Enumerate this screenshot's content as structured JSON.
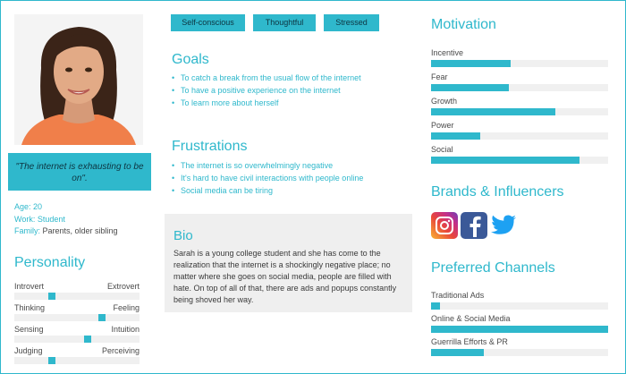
{
  "quote": "\"The internet is exhausting to be on\".",
  "details": {
    "age_label": "Age:",
    "age_value": "20",
    "work_label": "Work:",
    "work_value": "Student",
    "family_label": "Family:",
    "family_value": "Parents, older sibling"
  },
  "personality": {
    "title": "Personality",
    "rows": [
      {
        "left": "Introvert",
        "right": "Extrovert",
        "value": 0.29
      },
      {
        "left": "Thinking",
        "right": "Feeling",
        "value": 0.71
      },
      {
        "left": "Sensing",
        "right": "Intuition",
        "value": 0.59
      },
      {
        "left": "Judging",
        "right": "Perceiving",
        "value": 0.29
      }
    ]
  },
  "tags": [
    "Self-conscious",
    "Thoughtful",
    "Stressed"
  ],
  "goals": {
    "title": "Goals",
    "items": [
      "To catch a break from the usual flow of the internet",
      "To have a positive experience on the internet",
      "To learn more about herself"
    ]
  },
  "frustrations": {
    "title": "Frustrations",
    "items": [
      "The internet is so overwhelmingly negative",
      "It's hard to have civil interactions with people online",
      "Social media can be tiring"
    ]
  },
  "bio": {
    "title": "Bio",
    "text": "Sarah is a young college student and she has come to the realization that the internet is a shockingly negative place; no matter where she goes on social media, people are filled with hate. On top of all of that, there are ads and popups constantly being shoved her way."
  },
  "motivation": {
    "title": "Motivation",
    "items": [
      {
        "label": "Incentive",
        "value": 0.45
      },
      {
        "label": "Fear",
        "value": 0.44
      },
      {
        "label": "Growth",
        "value": 0.7
      },
      {
        "label": "Power",
        "value": 0.28
      },
      {
        "label": "Social",
        "value": 0.84
      }
    ]
  },
  "brands": {
    "title": "Brands & Influencers",
    "icons": [
      "instagram-icon",
      "facebook-icon",
      "twitter-icon"
    ]
  },
  "channels": {
    "title": "Preferred Channels",
    "items": [
      {
        "label": "Traditional Ads",
        "value": 0.05
      },
      {
        "label": "Online & Social Media",
        "value": 1.0
      },
      {
        "label": "Guerrilla Efforts & PR",
        "value": 0.3
      }
    ]
  },
  "colors": {
    "accent": "#2fb8cc",
    "muted_track": "#f0f0f0",
    "bio_bg": "#efefef"
  }
}
